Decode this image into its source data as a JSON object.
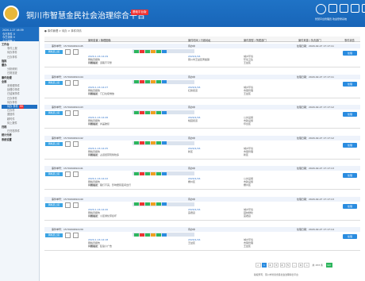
{
  "header": {
    "title": "铜川市智慧金民社会治理综合平台",
    "badge": "基础平台版",
    "user": "智慧平台管理员 欢迎登录系统"
  },
  "sidebar": {
    "date_lines": [
      "2020-1-27 16:39",
      "今日事件 0",
      "今日流转 0",
      "今日预警 0"
    ],
    "items": [
      {
        "label": "工作台",
        "level": "top"
      },
      {
        "label": "事件上报",
        "level": "sub"
      },
      {
        "label": "待办事件",
        "level": "sub"
      },
      {
        "label": "已办事件",
        "level": "sub"
      },
      {
        "label": "指挥",
        "level": "top"
      },
      {
        "label": "督办",
        "level": "top"
      },
      {
        "label": "分析研判",
        "level": "sub"
      },
      {
        "label": "日常巡查",
        "level": "sub"
      },
      {
        "label": "事件处理",
        "level": "top"
      },
      {
        "label": "全部",
        "level": "top"
      },
      {
        "label": "未受理事件",
        "level": "sub"
      },
      {
        "label": "处理中事件",
        "level": "sub"
      },
      {
        "label": "已结案事件",
        "level": "sub"
      },
      {
        "label": "已办事件",
        "level": "sub"
      },
      {
        "label": "待办事件",
        "level": "sub"
      },
      {
        "label": "待办 事件",
        "level": "sub",
        "active": true,
        "count": "99"
      },
      {
        "label": "已办件",
        "level": "sub"
      },
      {
        "label": "退回件",
        "level": "sub"
      },
      {
        "label": "超时件",
        "level": "sub"
      },
      {
        "label": "待上报件",
        "level": "sub"
      },
      {
        "label": "归档",
        "level": "top"
      },
      {
        "label": "已归档事件",
        "level": "sub"
      },
      {
        "label": "统计分析",
        "level": "top"
      },
      {
        "label": "系统设置",
        "level": "top"
      }
    ]
  },
  "breadcrumb": "● 事件管理 > 待办 > 事件详情",
  "columns": [
    "案例处置 / 管理图像",
    "案件时间 / 行政地址",
    "案件类型 / 所属部门",
    "案件来源 / 负责部门",
    "事件状态"
  ],
  "rows": [
    {
      "code": "事件单号：1579160694145",
      "tag": "网格员上报",
      "status_badge": "待办中",
      "date": "处理日期：2020-02-27 17:17:11",
      "time": "2020-1-16 14:29",
      "src": "网格员报告",
      "sum1": "问题描述：",
      "sum2": "道路不平整",
      "addr1": "2020/1/16",
      "addr2": "铜川市王益区黄堡镇",
      "type1": "城乡环境",
      "type2": "环境卫生",
      "dept": "王益区",
      "btn": "处理"
    },
    {
      "code": "事件单号：1579160694144",
      "tag": "网格员上报",
      "status_badge": "待办中",
      "date": "处理日期：2020-02-27 17:17:11",
      "time": "2020-1-16 14:27",
      "src": "网格员报告",
      "sum1": "问题描述：",
      "sum2": "门口垃圾堆放",
      "addr1": "2020/1/16",
      "addr2": "红旗街道",
      "type1": "城乡环境",
      "type2": "市容管理",
      "dept": "王益区",
      "btn": "处理"
    },
    {
      "code": "事件单号：1579160694143",
      "tag": "网格员上报",
      "status_badge": "待办中",
      "date": "处理日期：2020-02-27 17:17:12",
      "time": "2020-1-16 14:26",
      "src": "网格员报告",
      "sum1": "问题描述：",
      "sum2": "井盖破损",
      "addr1": "2020/1/16",
      "addr2": "桃园街道",
      "type1": "公共设施",
      "type2": "市政设施",
      "dept": "印台区",
      "btn": "处理"
    },
    {
      "code": "事件单号：1579160694142",
      "tag": "网格员上报",
      "status_badge": "待办中",
      "date": "处理日期：2020-02-27 17:17:12",
      "time": "2020-1-16 14:25",
      "src": "网格员报告",
      "sum1": "问题描述：",
      "sum2": "占道经营现象较多",
      "addr1": "2020/1/16",
      "addr2": "新区",
      "type1": "城乡环境",
      "type2": "市容管理",
      "dept": "新区",
      "btn": "处理"
    },
    {
      "code": "事件单号：1579160694141",
      "tag": "网格员上报",
      "status_badge": "待办中",
      "date": "处理日期：2020-02-27 17:17:13",
      "time": "2020-1-16 14:22",
      "src": "网格员报告",
      "sum1": "问题描述：",
      "sum2": "路灯不亮，影响居民夜间出行",
      "addr1": "2020/1/16",
      "addr2": "耀州区",
      "type1": "公共设施",
      "type2": "市政设施",
      "dept": "耀州区",
      "btn": "处理"
    },
    {
      "code": "事件单号：1579160694140",
      "tag": "网格员上报",
      "status_badge": "待办中",
      "date": "处理日期：2020-02-27 17:17:13",
      "time": "2020-1-16 14:20",
      "src": "网格员报告",
      "sum1": "问题描述：",
      "sum2": "小区绿化带损坏",
      "addr1": "2020/1/16",
      "addr2": "宜君县",
      "type1": "城乡环境",
      "type2": "园林绿化",
      "dept": "宜君县",
      "btn": "处理"
    },
    {
      "code": "事件单号：1579160694139",
      "tag": "网格员上报",
      "status_badge": "待办中",
      "date": "处理日期：2020-02-27 17:17:14",
      "time": "2020-1-16 14:18",
      "src": "网格员报告",
      "sum1": "问题描述：",
      "sum2": "乱贴小广告",
      "addr1": "2020/1/16",
      "addr2": "王益区",
      "type1": "城乡环境",
      "type2": "市容管理",
      "dept": "王益区",
      "btn": "处理"
    }
  ],
  "pager": {
    "pages": [
      "<",
      "1",
      "2",
      "3",
      "4",
      "5",
      "...",
      "9",
      ">"
    ],
    "info": "共 153 条",
    "go": "GO"
  },
  "footer": "版权所有：铜川市智慧金民社会治理综合平台"
}
